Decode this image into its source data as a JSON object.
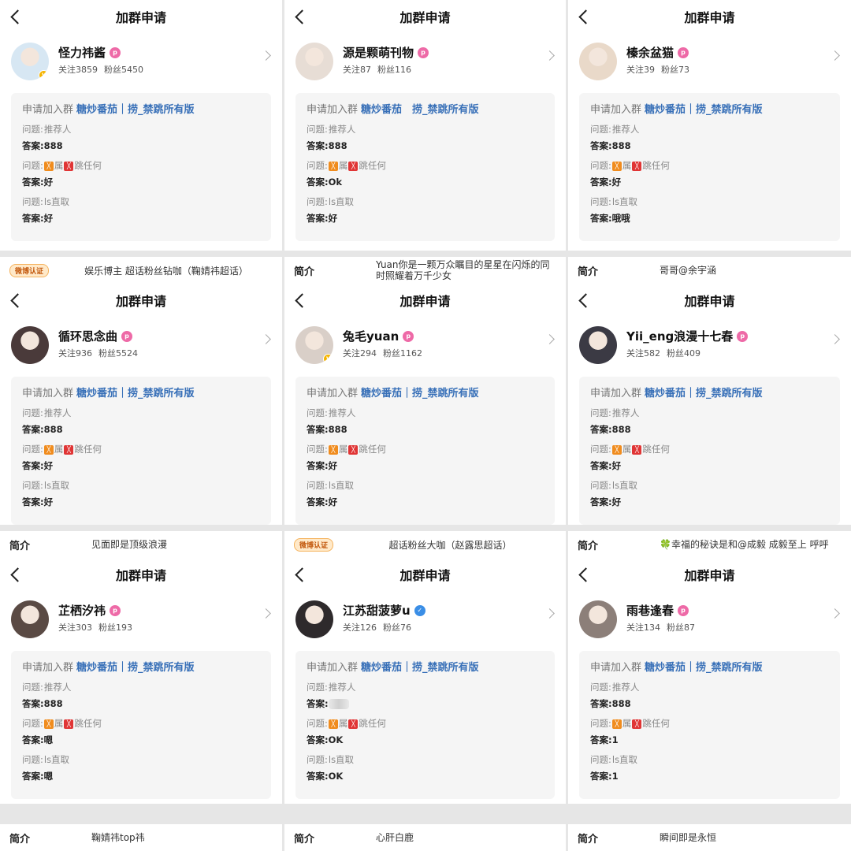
{
  "panel_title": "加群申请",
  "apply_label": "申请加入群",
  "question_label": "问题:",
  "answer_label": "答案:",
  "intro_label": "简介",
  "q1": "推荐人",
  "q2_parts": [
    "属",
    "跳任何"
  ],
  "q2_icons": [
    "o-icon",
    "r-icon"
  ],
  "q3": "ls直取",
  "panels": [
    {
      "name": "怪力祎酱",
      "follow": "关注3859",
      "fans": "粉丝5450",
      "group": "糖炒番茄｜捞_禁跳所有版",
      "a1": "888",
      "a2": "好",
      "a3": "好",
      "avatar_color": "#d7e7f3",
      "badge": "v"
    },
    {
      "name": "源是颗萌刊物",
      "follow": "关注87",
      "fans": "粉丝116",
      "group": "糖炒番茄　捞_禁跳所有版",
      "a1": "888",
      "a2": "Ok",
      "a3": "好",
      "avatar_color": "#e7ddd5",
      "badge": ""
    },
    {
      "name": "榛余盆猫",
      "follow": "关注39",
      "fans": "粉丝73",
      "group": "糖炒番茄｜捞_禁跳所有版",
      "a1": "888",
      "a2": "好",
      "a3": "哦哦",
      "avatar_color": "#e9d9c9",
      "badge": ""
    },
    {
      "name": "循环思念曲",
      "follow": "关注936",
      "fans": "粉丝5524",
      "group": "糖炒番茄｜捞_禁跳所有版",
      "a1": "888",
      "a2": "好",
      "a3": "好",
      "avatar_color": "#4a3a3a",
      "badge": ""
    },
    {
      "name": "兔毛yuan",
      "follow": "关注294",
      "fans": "粉丝1162",
      "group": "糖炒番茄｜捞_禁跳所有版",
      "a1": "888",
      "a2": "好",
      "a3": "好",
      "avatar_color": "#d9cfc8",
      "badge": "v"
    },
    {
      "name": "Yii_eng浪漫十七春",
      "follow": "关注582",
      "fans": "粉丝409",
      "group": "糖炒番茄｜捞_禁跳所有版",
      "a1": "888",
      "a2": "好",
      "a3": "好",
      "avatar_color": "#3b3a44",
      "badge": ""
    },
    {
      "name": "芷栖汐祎",
      "follow": "关注303",
      "fans": "粉丝193",
      "group": "糖炒番茄｜捞_禁跳所有版",
      "a1": "888",
      "a2": "嗯",
      "a3": "嗯",
      "avatar_color": "#5a4a44",
      "badge": ""
    },
    {
      "name": "江苏甜菠萝u",
      "follow": "关注126",
      "fans": "粉丝76",
      "group": "糖炒番茄｜捞_禁跳所有版",
      "a1": "",
      "a2": "OK",
      "a3": "OK",
      "avatar_color": "#2e2a2c",
      "badge": "",
      "blur_a1": true,
      "blue_tag": true
    },
    {
      "name": "雨巷逢春",
      "follow": "关注134",
      "fans": "粉丝87",
      "group": "糖炒番茄｜捞_禁跳所有版",
      "a1": "888",
      "a2": "1",
      "a3": "1",
      "avatar_color": "#8c7f79",
      "badge": ""
    }
  ],
  "strips": {
    "row1": [
      {
        "badge": "微博认证",
        "text": "娱乐博主 超话粉丝钻咖（鞠婧祎超话）"
      },
      {
        "text": "Yuan你是一颗万众瞩目的星星在闪烁的同时照耀着万千少女"
      },
      {
        "text": "哥哥@余宇涵"
      }
    ],
    "row2": [
      {
        "text": "见面即是顶级浪漫"
      },
      {
        "badge": "微博认证",
        "text": "超话粉丝大咖（赵露思超话）"
      },
      {
        "text": "🍀幸福的秘诀是和@成毅 成毅至上 呼呼"
      }
    ],
    "row3": [
      {
        "text": "鞠婧祎top祎"
      },
      {
        "text": "心肝白鹿"
      },
      {
        "text": "瞬间即是永恒"
      }
    ]
  },
  "colors": {
    "group_link": "#3870b8",
    "tag_pink": "#ee6aa7",
    "card_bg": "#f5f5f5"
  }
}
